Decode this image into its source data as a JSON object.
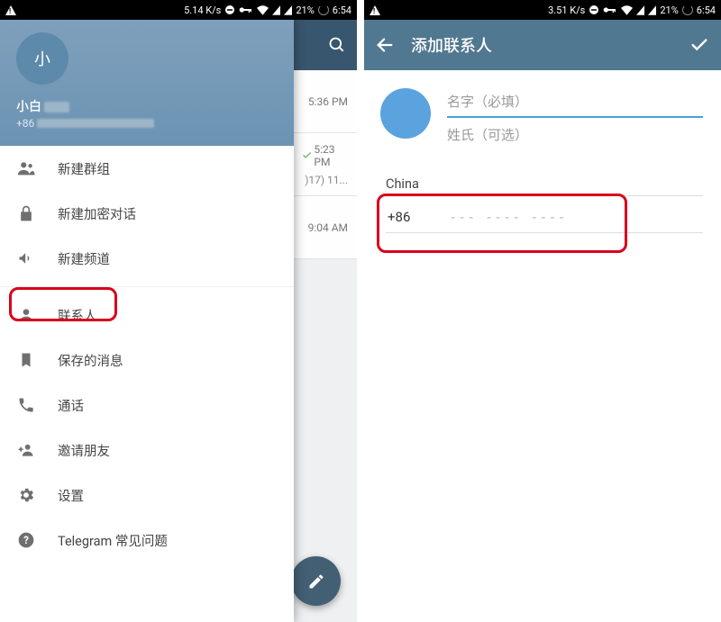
{
  "status": {
    "net_speed_left": "5.14 K/s",
    "net_speed_right": "3.51 K/s",
    "battery": "21%",
    "time": "6:54"
  },
  "left_screen": {
    "avatar_initial": "小",
    "username": "小白",
    "phone_prefix": "+86",
    "bg_chats": [
      {
        "time": "5:36 PM"
      },
      {
        "time": "5:23 PM",
        "preview": ")17) 11..."
      },
      {
        "time": "9:04 AM"
      }
    ],
    "menu": {
      "new_group": "新建群组",
      "new_secret_chat": "新建加密对话",
      "new_channel": "新建频道",
      "contacts": "联系人",
      "saved_messages": "保存的消息",
      "calls": "通话",
      "invite_friends": "邀请朋友",
      "settings": "设置",
      "faq": "Telegram 常见问题"
    }
  },
  "right_screen": {
    "title": "添加联系人",
    "first_name_placeholder": "名字（必填）",
    "last_name_placeholder": "姓氏（可选）",
    "country": "China",
    "dial_code": "+86",
    "phone_placeholder": "--- ---- ----"
  }
}
